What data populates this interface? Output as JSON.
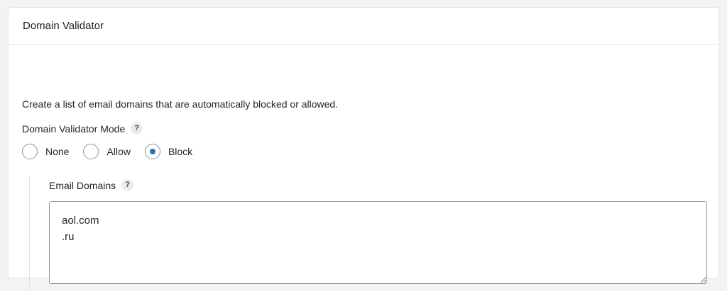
{
  "card": {
    "title": "Domain Validator",
    "description": "Create a list of email domains that are automatically blocked or allowed."
  },
  "mode": {
    "label": "Domain Validator Mode",
    "help_glyph": "?",
    "options": [
      {
        "label": "None",
        "checked": false
      },
      {
        "label": "Allow",
        "checked": false
      },
      {
        "label": "Block",
        "checked": true
      }
    ]
  },
  "domains": {
    "label": "Email Domains",
    "help_glyph": "?",
    "value": "aol.com\n.ru"
  },
  "colors": {
    "accent": "#2f6fb0",
    "page_background": "#f1f3f5",
    "card_background": "#ffffff"
  },
  "icons": {
    "help": "help-question-icon",
    "resize": "resize-grip-icon"
  }
}
